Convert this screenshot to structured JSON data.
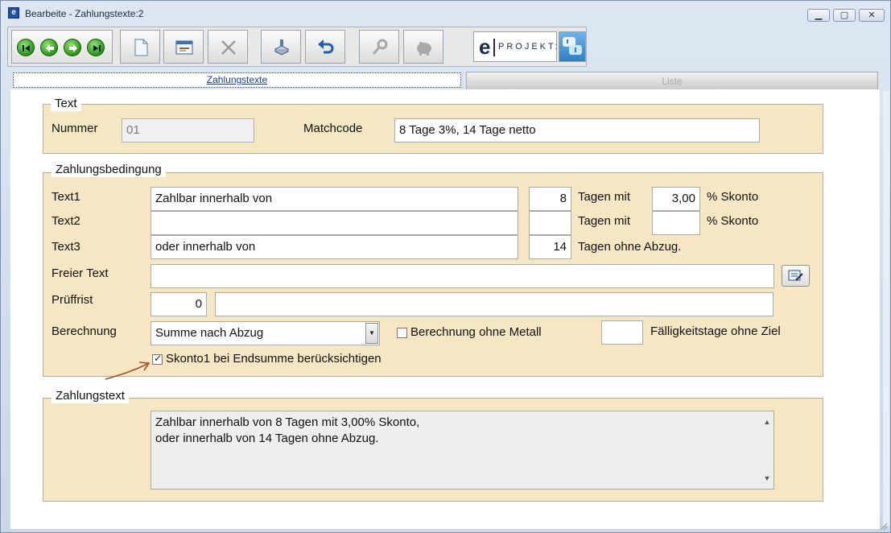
{
  "window": {
    "title": "Bearbeite - Zahlungstexte:2",
    "app_icon_letter": "e",
    "minimize_symbol": "▁",
    "maximize_symbol": "▢",
    "close_symbol": "✕"
  },
  "toolbar": {
    "buttons": [
      "first-record",
      "previous-record",
      "next-record",
      "last-record",
      "new-document",
      "edit-form",
      "delete",
      "save",
      "undo",
      "key",
      "piggy-bank"
    ],
    "eprojekt_logo_letter": "e",
    "eprojekt_label": "PROJEKT:"
  },
  "tabs": [
    {
      "label": "Zahlungstexte",
      "active": true
    },
    {
      "label": "Liste",
      "active": false
    }
  ],
  "text_group": {
    "title": "Text",
    "nummer_label": "Nummer",
    "nummer_value": "01",
    "matchcode_label": "Matchcode",
    "matchcode_value": "8 Tage 3%, 14 Tage netto"
  },
  "zahlungsbedingung": {
    "title": "Zahlungsbedingung",
    "rows": [
      {
        "label": "Text1",
        "text": "Zahlbar innerhalb von",
        "days": "8",
        "days_label": "Tagen mit",
        "percent": "3,00",
        "percent_label": "% Skonto"
      },
      {
        "label": "Text2",
        "text": "",
        "days": "",
        "days_label": "Tagen mit",
        "percent": "",
        "percent_label": "% Skonto"
      },
      {
        "label": "Text3",
        "text": "oder innerhalb von",
        "days": "14",
        "days_label": "Tagen ohne Abzug."
      }
    ],
    "freier_text_label": "Freier Text",
    "freier_text_value": "",
    "prueffrist_label": "Prüffrist",
    "prueffrist_value": "0",
    "prueffrist_text": "",
    "berechnung_label": "Berechnung",
    "berechnung_value": "Summe nach Abzug",
    "ohne_metall_label": "Berechnung ohne Metall",
    "ohne_metall_checked": false,
    "faelligkeit_value": "",
    "faelligkeit_label": "Fälligkeitstage ohne Ziel",
    "skonto1_label": "Skonto1 bei Endsumme berücksichtigen",
    "skonto1_checked": true,
    "check_mark": "✓",
    "dropdown_arrow": "▼"
  },
  "zahlungstext": {
    "title": "Zahlungstext",
    "line1": "Zahlbar innerhalb von 8 Tagen mit 3,00% Skonto,",
    "line2": "oder innerhalb von 14 Tagen ohne Abzug.",
    "scroll_up": "▲",
    "scroll_down": "▼"
  },
  "colors": {
    "group_background": "#f5e6c4",
    "annotation_arrow": "#a0502a",
    "tab_link": "#1f3c8c"
  }
}
